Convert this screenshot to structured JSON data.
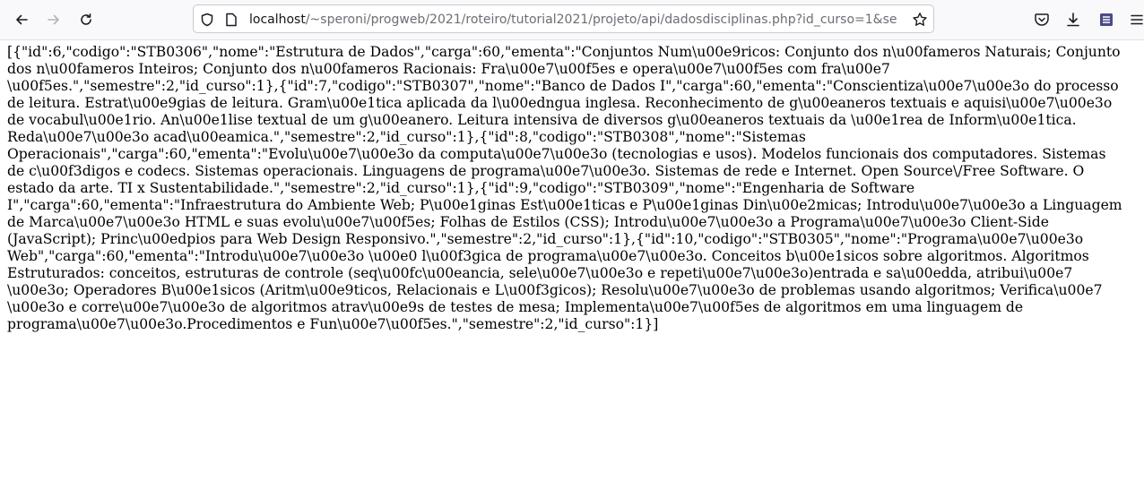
{
  "browser": {
    "url_host": "localhost",
    "url_path": "/~speroni/progweb/2021/roteiro/tutorial2021/projeto/api/dadosdisciplinas.php?id_curso=1&se",
    "icons": [
      "back-icon",
      "forward-icon",
      "reload-icon",
      "shield-icon",
      "page-icon",
      "star-icon",
      "pocket-icon",
      "download-icon",
      "extension-icon",
      "menu-icon"
    ]
  },
  "json_lines": [
    "[{\"id\":6,\"codigo\":\"STB0306\",\"nome\":\"Estrutura de Dados\",\"carga\":60,\"ementa\":\"Conjuntos Num\\u00e9ricos: Conjunto dos n\\u00fameros Naturais; Conjunto",
    "dos n\\u00fameros Inteiros; Conjunto dos n\\u00fameros Racionais: Fra\\u00e7\\u00f5es e opera\\u00e7\\u00f5es com fra\\u00e7",
    "\\u00f5es.\",\"semestre\":2,\"id_curso\":1},{\"id\":7,\"codigo\":\"STB0307\",\"nome\":\"Banco de Dados I\",\"carga\":60,\"ementa\":\"Conscientiza\\u00e7\\u00e3o do processo",
    "de leitura. Estrat\\u00e9gias de leitura. Gram\\u00e1tica aplicada da l\\u00edngua inglesa. Reconhecimento de g\\u00eaneros textuais e aquisi\\u00e7\\u00e3o",
    "de vocabul\\u00e1rio. An\\u00e1lise textual de um g\\u00eanero. Leitura intensiva de diversos g\\u00eaneros textuais da \\u00e1rea de Inform\\u00e1tica.",
    "Reda\\u00e7\\u00e3o acad\\u00eamica.\",\"semestre\":2,\"id_curso\":1},{\"id\":8,\"codigo\":\"STB0308\",\"nome\":\"Sistemas",
    "Operacionais\",\"carga\":60,\"ementa\":\"Evolu\\u00e7\\u00e3o da computa\\u00e7\\u00e3o (tecnologias e usos). Modelos funcionais dos computadores. Sistemas",
    "de c\\u00f3digos e codecs. Sistemas operacionais. Linguagens de programa\\u00e7\\u00e3o. Sistemas de rede e Internet. Open Source\\/Free Software. O",
    "estado da arte. TI x Sustentabilidade.\",\"semestre\":2,\"id_curso\":1},{\"id\":9,\"codigo\":\"STB0309\",\"nome\":\"Engenharia de Software",
    "I\",\"carga\":60,\"ementa\":\"Infraestrutura do Ambiente Web; P\\u00e1ginas Est\\u00e1ticas e P\\u00e1ginas Din\\u00e2micas; Introdu\\u00e7\\u00e3o a Linguagem",
    "de Marca\\u00e7\\u00e3o HTML e suas evolu\\u00e7\\u00f5es; Folhas de Estilos (CSS); Introdu\\u00e7\\u00e3o a Programa\\u00e7\\u00e3o Client-Side",
    "(JavaScript); Princ\\u00edpios para Web Design Responsivo.\",\"semestre\":2,\"id_curso\":1},{\"id\":10,\"codigo\":\"STB0305\",\"nome\":\"Programa\\u00e7\\u00e3o",
    "Web\",\"carga\":60,\"ementa\":\"Introdu\\u00e7\\u00e3o \\u00e0 l\\u00f3gica de programa\\u00e7\\u00e3o. Conceitos b\\u00e1sicos sobre algoritmos. Algoritmos",
    "Estruturados: conceitos, estruturas de controle (seq\\u00fc\\u00eancia, sele\\u00e7\\u00e3o e repeti\\u00e7\\u00e3o)entrada e sa\\u00edda, atribui\\u00e7",
    "\\u00e3o; Operadores B\\u00e1sicos (Aritm\\u00e9ticos, Relacionais e L\\u00f3gicos); Resolu\\u00e7\\u00e3o de problemas usando algoritmos; Verifica\\u00e7",
    "\\u00e3o e corre\\u00e7\\u00e3o de algoritmos atrav\\u00e9s de testes de mesa; Implementa\\u00e7\\u00f5es de algoritmos em uma linguagem de",
    "programa\\u00e7\\u00e3o.Procedimentos e Fun\\u00e7\\u00f5es.\",\"semestre\":2,\"id_curso\":1}]"
  ]
}
